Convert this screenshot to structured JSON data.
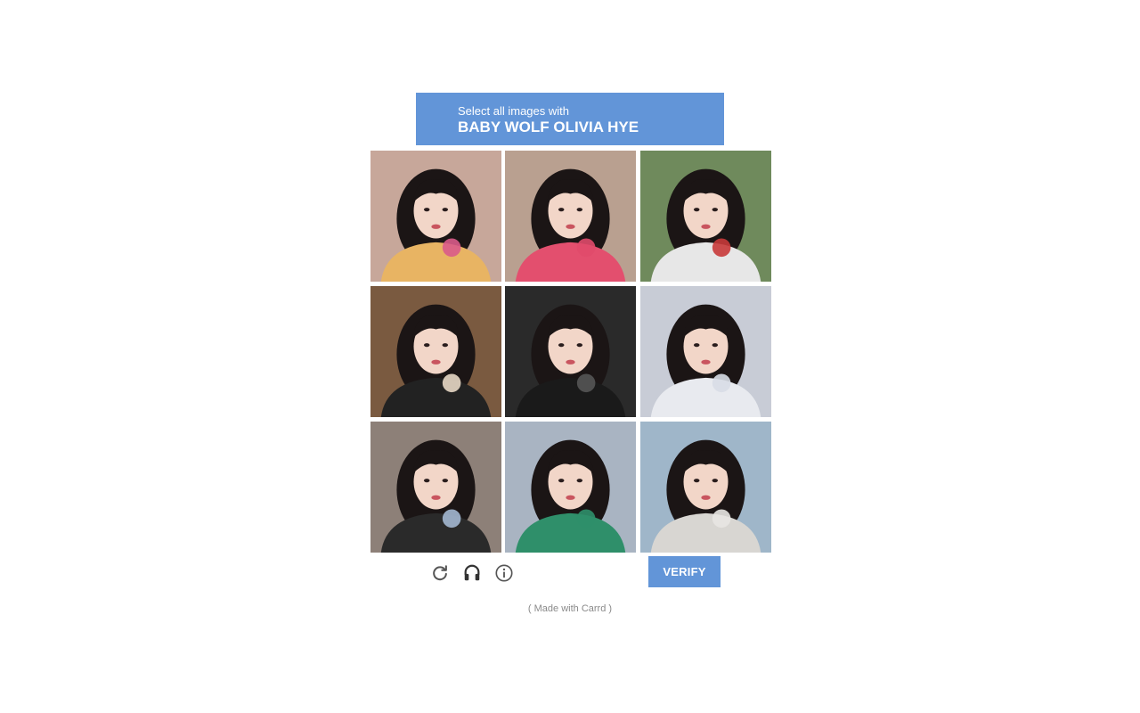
{
  "prompt": {
    "subtitle": "Select all images with",
    "target": "BABY WOLF OLIVIA HYE"
  },
  "grid": {
    "tiles": [
      {
        "scene": "girl-heart-pink-cake",
        "bg": "#c7a79a",
        "accent": "#d95b8a",
        "shirt": "#e8b463"
      },
      {
        "scene": "girl-red-sweater-chopsticks",
        "bg": "#b9a090",
        "accent": "#e04a6a",
        "shirt": "#e34f6e"
      },
      {
        "scene": "girl-trees-lollipop",
        "bg": "#6f8a5c",
        "accent": "#c83a3a",
        "shirt": "#e7e7e7"
      },
      {
        "scene": "girl-black-cap-eating",
        "bg": "#7a5a40",
        "accent": "#e7d7c4",
        "shirt": "#222222"
      },
      {
        "scene": "girl-headphones-mic-dark",
        "bg": "#2a2a2a",
        "accent": "#555555",
        "shirt": "#1a1a1a"
      },
      {
        "scene": "girl-white-puffer-coat",
        "bg": "#c8ccd6",
        "accent": "#d8dde6",
        "shirt": "#e8eaef"
      },
      {
        "scene": "girl-hand-sign-bow",
        "bg": "#8d8078",
        "accent": "#a3b7d0",
        "shirt": "#2a2a2a"
      },
      {
        "scene": "girl-smiling-green-top",
        "bg": "#a9b4c2",
        "accent": "#2f8f6a",
        "shirt": "#2f8f6a"
      },
      {
        "scene": "girl-drinking-straw",
        "bg": "#9fb6c9",
        "accent": "#e8e6e2",
        "shirt": "#d8d6d2"
      }
    ]
  },
  "controls": {
    "reload_icon": "reload-icon",
    "audio_icon": "headphones-icon",
    "info_icon": "info-icon",
    "verify_label": "VERIFY"
  },
  "footer": {
    "credit": "( Made with Carrd )"
  },
  "colors": {
    "accent": "#6295d8",
    "icon": "#555555"
  }
}
